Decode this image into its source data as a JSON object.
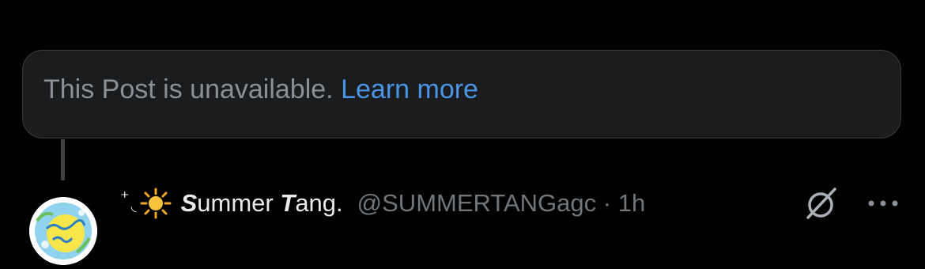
{
  "notice": {
    "text": "This Post is unavailable.",
    "link_label": "Learn more"
  },
  "reply": {
    "avatar": {
      "icon": "summer-tang-avatar",
      "label": "Summer Tang"
    },
    "name_decoration_prefix": "⁺",
    "name_decoration_arc": "◟",
    "name_emoji_icon": "sun-icon",
    "display_name_s": "S",
    "display_name_ummer": "ummer ",
    "display_name_t": "T",
    "display_name_ang": "ang.",
    "handle": "@SUMMERTANGagc",
    "separator": "·",
    "time": "1h"
  },
  "actions": {
    "grok_icon": "grok-icon",
    "more_icon": "more-options-icon"
  },
  "colors": {
    "background": "#000000",
    "card": "#1b1c1e",
    "link": "#4b95e6",
    "muted": "#71767b"
  }
}
